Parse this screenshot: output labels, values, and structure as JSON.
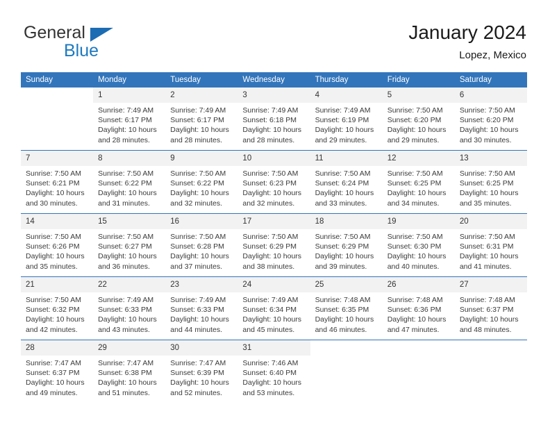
{
  "brand": {
    "name_top": "General",
    "name_bottom": "Blue",
    "flag_color": "#1c6cb3",
    "blue_text_color": "#1c79c0"
  },
  "header": {
    "month_title": "January 2024",
    "location": "Lopez, Mexico",
    "header_bg_color": "#3275bb",
    "daynum_bg_color": "#f2f2f2"
  },
  "weekday_headers": [
    "Sunday",
    "Monday",
    "Tuesday",
    "Wednesday",
    "Thursday",
    "Friday",
    "Saturday"
  ],
  "labels": {
    "sunrise_prefix": "Sunrise:",
    "sunset_prefix": "Sunset:",
    "daylight_prefix": "Daylight:"
  },
  "weeks": [
    [
      {
        "day": "",
        "sunrise": "",
        "sunset": "",
        "daylight_line1": "",
        "daylight_line2": ""
      },
      {
        "day": "1",
        "sunrise": "Sunrise: 7:49 AM",
        "sunset": "Sunset: 6:17 PM",
        "daylight_line1": "Daylight: 10 hours",
        "daylight_line2": "and 28 minutes."
      },
      {
        "day": "2",
        "sunrise": "Sunrise: 7:49 AM",
        "sunset": "Sunset: 6:17 PM",
        "daylight_line1": "Daylight: 10 hours",
        "daylight_line2": "and 28 minutes."
      },
      {
        "day": "3",
        "sunrise": "Sunrise: 7:49 AM",
        "sunset": "Sunset: 6:18 PM",
        "daylight_line1": "Daylight: 10 hours",
        "daylight_line2": "and 28 minutes."
      },
      {
        "day": "4",
        "sunrise": "Sunrise: 7:49 AM",
        "sunset": "Sunset: 6:19 PM",
        "daylight_line1": "Daylight: 10 hours",
        "daylight_line2": "and 29 minutes."
      },
      {
        "day": "5",
        "sunrise": "Sunrise: 7:50 AM",
        "sunset": "Sunset: 6:20 PM",
        "daylight_line1": "Daylight: 10 hours",
        "daylight_line2": "and 29 minutes."
      },
      {
        "day": "6",
        "sunrise": "Sunrise: 7:50 AM",
        "sunset": "Sunset: 6:20 PM",
        "daylight_line1": "Daylight: 10 hours",
        "daylight_line2": "and 30 minutes."
      }
    ],
    [
      {
        "day": "7",
        "sunrise": "Sunrise: 7:50 AM",
        "sunset": "Sunset: 6:21 PM",
        "daylight_line1": "Daylight: 10 hours",
        "daylight_line2": "and 30 minutes."
      },
      {
        "day": "8",
        "sunrise": "Sunrise: 7:50 AM",
        "sunset": "Sunset: 6:22 PM",
        "daylight_line1": "Daylight: 10 hours",
        "daylight_line2": "and 31 minutes."
      },
      {
        "day": "9",
        "sunrise": "Sunrise: 7:50 AM",
        "sunset": "Sunset: 6:22 PM",
        "daylight_line1": "Daylight: 10 hours",
        "daylight_line2": "and 32 minutes."
      },
      {
        "day": "10",
        "sunrise": "Sunrise: 7:50 AM",
        "sunset": "Sunset: 6:23 PM",
        "daylight_line1": "Daylight: 10 hours",
        "daylight_line2": "and 32 minutes."
      },
      {
        "day": "11",
        "sunrise": "Sunrise: 7:50 AM",
        "sunset": "Sunset: 6:24 PM",
        "daylight_line1": "Daylight: 10 hours",
        "daylight_line2": "and 33 minutes."
      },
      {
        "day": "12",
        "sunrise": "Sunrise: 7:50 AM",
        "sunset": "Sunset: 6:25 PM",
        "daylight_line1": "Daylight: 10 hours",
        "daylight_line2": "and 34 minutes."
      },
      {
        "day": "13",
        "sunrise": "Sunrise: 7:50 AM",
        "sunset": "Sunset: 6:25 PM",
        "daylight_line1": "Daylight: 10 hours",
        "daylight_line2": "and 35 minutes."
      }
    ],
    [
      {
        "day": "14",
        "sunrise": "Sunrise: 7:50 AM",
        "sunset": "Sunset: 6:26 PM",
        "daylight_line1": "Daylight: 10 hours",
        "daylight_line2": "and 35 minutes."
      },
      {
        "day": "15",
        "sunrise": "Sunrise: 7:50 AM",
        "sunset": "Sunset: 6:27 PM",
        "daylight_line1": "Daylight: 10 hours",
        "daylight_line2": "and 36 minutes."
      },
      {
        "day": "16",
        "sunrise": "Sunrise: 7:50 AM",
        "sunset": "Sunset: 6:28 PM",
        "daylight_line1": "Daylight: 10 hours",
        "daylight_line2": "and 37 minutes."
      },
      {
        "day": "17",
        "sunrise": "Sunrise: 7:50 AM",
        "sunset": "Sunset: 6:29 PM",
        "daylight_line1": "Daylight: 10 hours",
        "daylight_line2": "and 38 minutes."
      },
      {
        "day": "18",
        "sunrise": "Sunrise: 7:50 AM",
        "sunset": "Sunset: 6:29 PM",
        "daylight_line1": "Daylight: 10 hours",
        "daylight_line2": "and 39 minutes."
      },
      {
        "day": "19",
        "sunrise": "Sunrise: 7:50 AM",
        "sunset": "Sunset: 6:30 PM",
        "daylight_line1": "Daylight: 10 hours",
        "daylight_line2": "and 40 minutes."
      },
      {
        "day": "20",
        "sunrise": "Sunrise: 7:50 AM",
        "sunset": "Sunset: 6:31 PM",
        "daylight_line1": "Daylight: 10 hours",
        "daylight_line2": "and 41 minutes."
      }
    ],
    [
      {
        "day": "21",
        "sunrise": "Sunrise: 7:50 AM",
        "sunset": "Sunset: 6:32 PM",
        "daylight_line1": "Daylight: 10 hours",
        "daylight_line2": "and 42 minutes."
      },
      {
        "day": "22",
        "sunrise": "Sunrise: 7:49 AM",
        "sunset": "Sunset: 6:33 PM",
        "daylight_line1": "Daylight: 10 hours",
        "daylight_line2": "and 43 minutes."
      },
      {
        "day": "23",
        "sunrise": "Sunrise: 7:49 AM",
        "sunset": "Sunset: 6:33 PM",
        "daylight_line1": "Daylight: 10 hours",
        "daylight_line2": "and 44 minutes."
      },
      {
        "day": "24",
        "sunrise": "Sunrise: 7:49 AM",
        "sunset": "Sunset: 6:34 PM",
        "daylight_line1": "Daylight: 10 hours",
        "daylight_line2": "and 45 minutes."
      },
      {
        "day": "25",
        "sunrise": "Sunrise: 7:48 AM",
        "sunset": "Sunset: 6:35 PM",
        "daylight_line1": "Daylight: 10 hours",
        "daylight_line2": "and 46 minutes."
      },
      {
        "day": "26",
        "sunrise": "Sunrise: 7:48 AM",
        "sunset": "Sunset: 6:36 PM",
        "daylight_line1": "Daylight: 10 hours",
        "daylight_line2": "and 47 minutes."
      },
      {
        "day": "27",
        "sunrise": "Sunrise: 7:48 AM",
        "sunset": "Sunset: 6:37 PM",
        "daylight_line1": "Daylight: 10 hours",
        "daylight_line2": "and 48 minutes."
      }
    ],
    [
      {
        "day": "28",
        "sunrise": "Sunrise: 7:47 AM",
        "sunset": "Sunset: 6:37 PM",
        "daylight_line1": "Daylight: 10 hours",
        "daylight_line2": "and 49 minutes."
      },
      {
        "day": "29",
        "sunrise": "Sunrise: 7:47 AM",
        "sunset": "Sunset: 6:38 PM",
        "daylight_line1": "Daylight: 10 hours",
        "daylight_line2": "and 51 minutes."
      },
      {
        "day": "30",
        "sunrise": "Sunrise: 7:47 AM",
        "sunset": "Sunset: 6:39 PM",
        "daylight_line1": "Daylight: 10 hours",
        "daylight_line2": "and 52 minutes."
      },
      {
        "day": "31",
        "sunrise": "Sunrise: 7:46 AM",
        "sunset": "Sunset: 6:40 PM",
        "daylight_line1": "Daylight: 10 hours",
        "daylight_line2": "and 53 minutes."
      },
      {
        "day": "",
        "sunrise": "",
        "sunset": "",
        "daylight_line1": "",
        "daylight_line2": ""
      },
      {
        "day": "",
        "sunrise": "",
        "sunset": "",
        "daylight_line1": "",
        "daylight_line2": ""
      },
      {
        "day": "",
        "sunrise": "",
        "sunset": "",
        "daylight_line1": "",
        "daylight_line2": ""
      }
    ]
  ]
}
